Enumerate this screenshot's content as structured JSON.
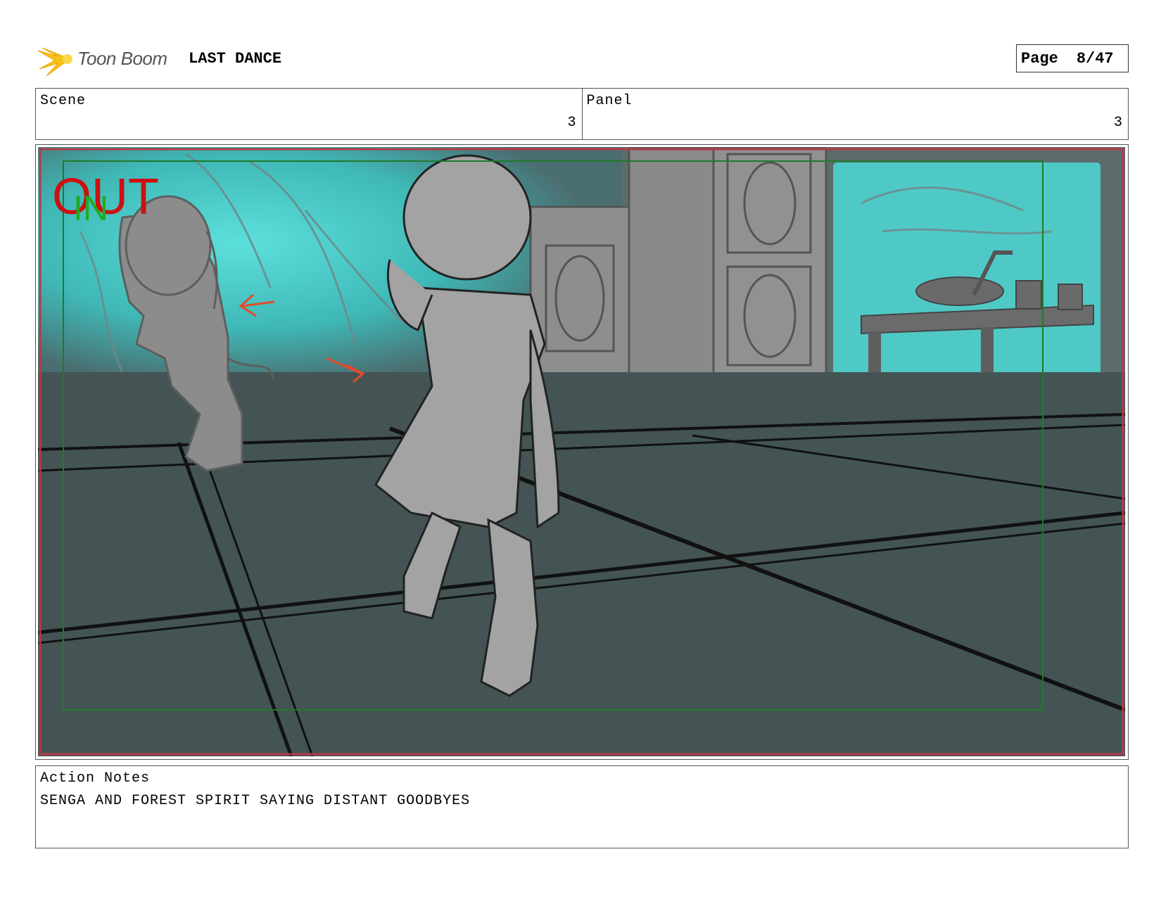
{
  "header": {
    "logo_text": "Toon Boom",
    "project_title": "LAST DANCE",
    "page_label": "Page",
    "page_value": "8/47"
  },
  "info": {
    "scene_label": "Scene",
    "scene_value": "3",
    "panel_label": "Panel",
    "panel_value": "3"
  },
  "panel": {
    "out_label": "OUT",
    "in_label": "IN",
    "colors": {
      "glow": "#4fd0cc",
      "floor": "#445454",
      "wall": "#5f6d6d",
      "out_text": "#cc1111",
      "in_text": "#22aa22",
      "arrow": "#e24a2a"
    }
  },
  "notes": {
    "label": "Action Notes",
    "text": "SENGA AND FOREST SPIRIT SAYING DISTANT GOODBYES"
  }
}
